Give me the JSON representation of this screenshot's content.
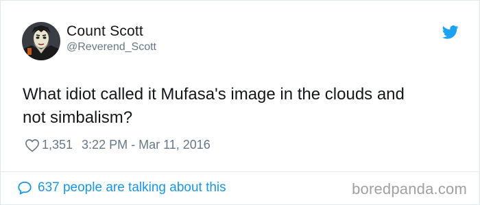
{
  "tweet": {
    "author_name": "Count Scott",
    "author_handle": "@Reverend_Scott",
    "text": "What idiot called it Mufasa's image in the clouds and\nnot simbalism?",
    "likes": "1,351",
    "timestamp": "3:22 PM - Mar 11, 2016",
    "conversation_link": "637 people are talking about this",
    "avatar_icon": "count-dracula-avatar",
    "platform_icon": "twitter-bird-icon"
  },
  "watermark": "boredpanda.com",
  "colors": {
    "link_blue": "#1b95e0",
    "twitter_blue": "#1da1f2",
    "text": "#14171a",
    "muted": "#657786",
    "border": "#e1e8ed"
  }
}
